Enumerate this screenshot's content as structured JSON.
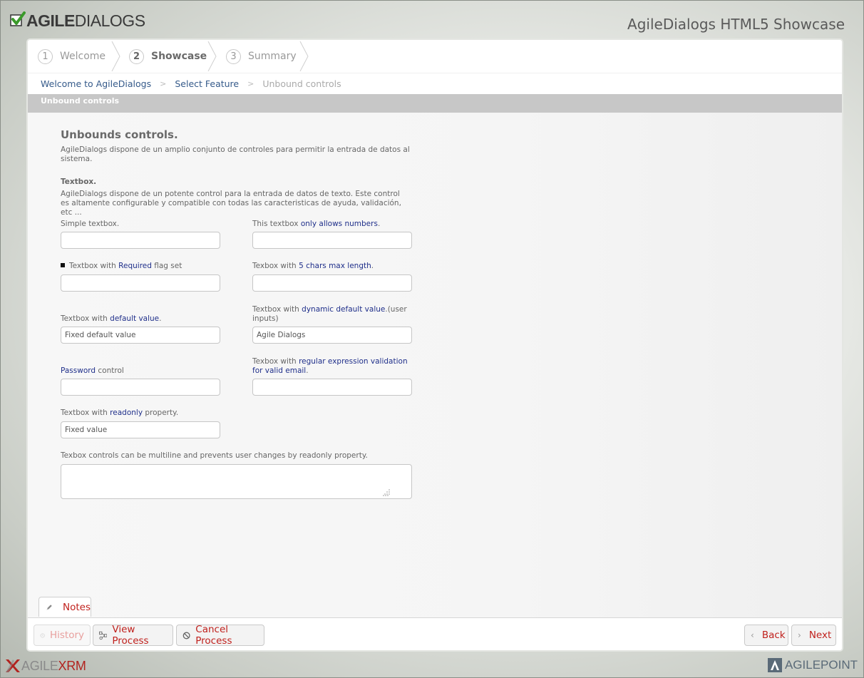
{
  "header": {
    "logo": {
      "bold": "AGILE",
      "light": "DIALOGS"
    },
    "title": "AgileDialogs HTML5 Showcase"
  },
  "steps": [
    {
      "num": "1",
      "label": "Welcome",
      "active": false
    },
    {
      "num": "2",
      "label": "Showcase",
      "active": true
    },
    {
      "num": "3",
      "label": "Summary",
      "active": false
    }
  ],
  "breadcrumb": {
    "items": [
      "Welcome to AgileDialogs",
      "Select Feature"
    ],
    "separator": ">",
    "current": "Unbound controls"
  },
  "section": {
    "title": "Unbound controls"
  },
  "form": {
    "title": "Unbounds controls.",
    "description": "AgileDialogs dispone de un amplio conjunto de controles para permitir la entrada de datos al sistema.",
    "textbox_heading": "Textbox.",
    "textbox_description": "AgileDialogs dispone de un potente control para la entrada de datos de texto. Este control es altamente configurable y compatible con todas las caracteristicas de ayuda, validación, etc ...",
    "fields": {
      "simple": {
        "label": "Simple textbox.",
        "value": ""
      },
      "numbers": {
        "pre": "This textbox ",
        "hl": "only allows numbers",
        "post": ".",
        "value": ""
      },
      "required": {
        "pre": "Textbox with ",
        "hl": "Required",
        "post": " flag set",
        "value": ""
      },
      "maxlen": {
        "pre": "Texbox with ",
        "hl": "5 chars max length",
        "post": ".",
        "value": ""
      },
      "default": {
        "pre": "Textbox with ",
        "hl": "default value",
        "post": ".",
        "value": "Fixed default value"
      },
      "dynamic": {
        "pre": "Textbox with ",
        "hl": "dynamic default value",
        "post": ".(user inputs)",
        "value": "Agile Dialogs"
      },
      "password": {
        "hl": "Password",
        "post": " control",
        "value": ""
      },
      "regex": {
        "pre": "Texbox with ",
        "hl": "regular expression validation for valid email",
        "post": ".",
        "value": ""
      },
      "readonly": {
        "pre": "Textbox with ",
        "hl": "readonly",
        "post": " property.",
        "value": "Fixed value"
      },
      "multiline": {
        "label": "Texbox controls can be multiline and prevents user changes by readonly property.",
        "value": ""
      }
    }
  },
  "notes": {
    "label": "Notes",
    "icon": "pencil-icon"
  },
  "footer": {
    "history": "History",
    "view_process": "View Process",
    "cancel_process": "Cancel Process",
    "back": "Back",
    "next": "Next"
  },
  "bottom": {
    "xrm": {
      "a": "AGILE",
      "b": "XRM"
    },
    "agilepoint": "AGILEPOINT"
  },
  "colors": {
    "accent": "#c0211d",
    "link": "#355a8a",
    "highlight": "#1f2f8a",
    "section_bar": "#c7c7c7"
  }
}
